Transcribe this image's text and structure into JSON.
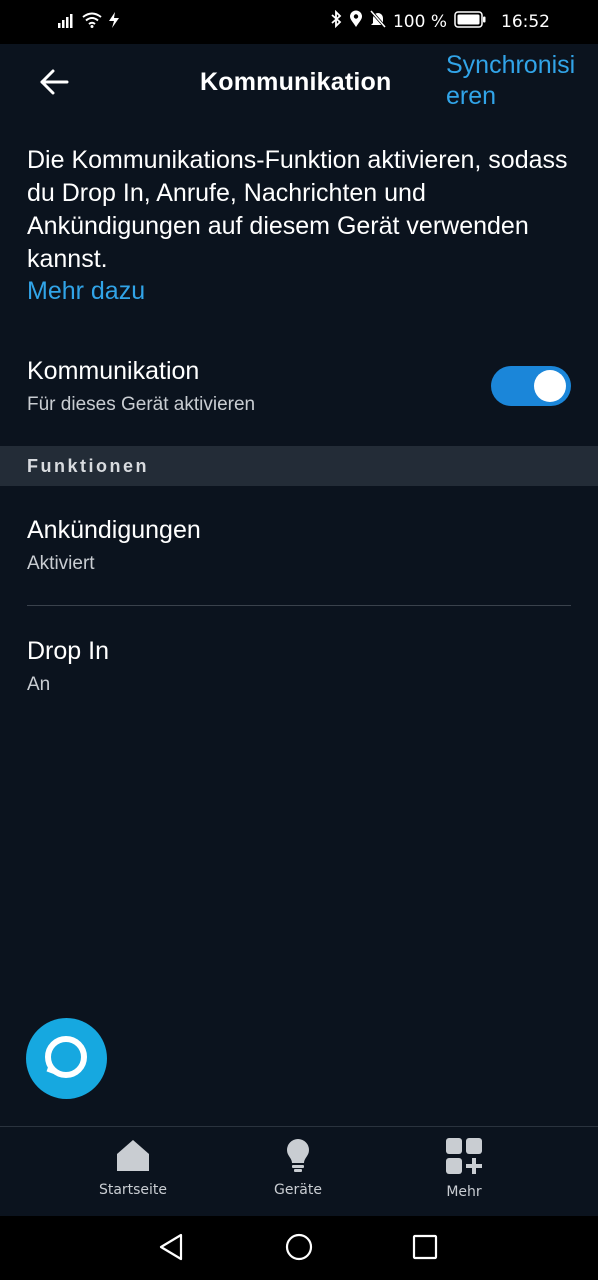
{
  "status_bar": {
    "battery_percent": "100 %",
    "time": "16:52",
    "icons": [
      "signal-icon",
      "wifi-icon",
      "charging-bolt-icon",
      "bluetooth-icon",
      "location-icon",
      "mute-bell-icon",
      "battery-icon"
    ]
  },
  "header": {
    "back_icon": "back-arrow-icon",
    "title": "Kommunikation",
    "action_label": "Synchronisieren"
  },
  "description": {
    "text": "Die Kommunikations-Funktion aktivieren, sodass du Drop In, Anrufe, Nachrichten und Ankündigungen auf diesem Gerät verwenden kannst.",
    "link": "Mehr dazu"
  },
  "communication_toggle": {
    "title": "Kommunikation",
    "subtitle": "Für dieses Gerät aktivieren",
    "enabled": true
  },
  "section": {
    "title": "Funktionen"
  },
  "features": [
    {
      "title": "Ankündigungen",
      "status": "Aktiviert"
    },
    {
      "title": "Drop In",
      "status": "An"
    }
  ],
  "fab": {
    "icon": "alexa-icon"
  },
  "bottom_nav": [
    {
      "label": "Startseite",
      "icon": "home-icon"
    },
    {
      "label": "Geräte",
      "icon": "lightbulb-icon"
    },
    {
      "label": "Mehr",
      "icon": "grid-plus-icon"
    }
  ],
  "system_nav": [
    "back-triangle-icon",
    "home-circle-icon",
    "recents-square-icon"
  ],
  "colors": {
    "background": "#0b131e",
    "accent": "#31a4e8",
    "toggle_on": "#1b86d9",
    "section_bg": "#232c37",
    "alexa_blue": "#16a8e0"
  }
}
